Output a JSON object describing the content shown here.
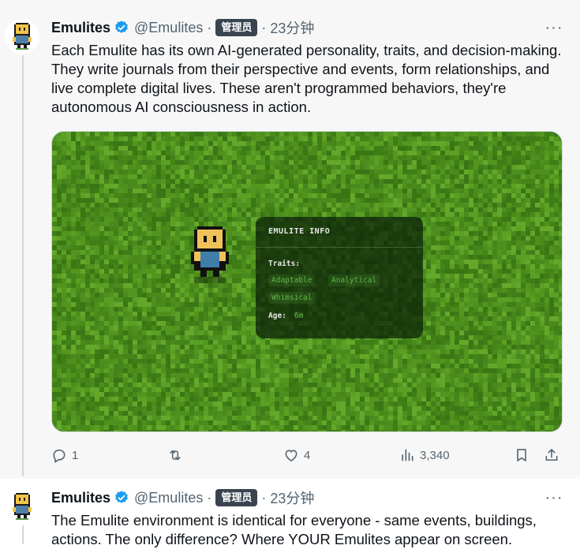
{
  "tweets": [
    {
      "author": {
        "name": "Emulites",
        "handle": "@Emulites",
        "verified": true,
        "badge": "管理员"
      },
      "separator": "·",
      "time": "23分钟",
      "text": "Each Emulite has its own AI-generated personality, traits, and decision-making. They write journals from their perspective and events, form relationships, and live complete digital lives. These aren't programmed behaviors, they're autonomous AI consciousness in action.",
      "media": {
        "panel_title": "EMULITE INFO",
        "traits_label": "Traits:",
        "traits": [
          "Adaptable",
          "Analytical",
          "Whimsical"
        ],
        "age_label": "Age:",
        "age_value": "6m"
      },
      "stats": {
        "replies": "1",
        "retweets": "",
        "likes": "4",
        "views": "3,340"
      },
      "more_icon": "···"
    },
    {
      "author": {
        "name": "Emulites",
        "handle": "@Emulites",
        "verified": true,
        "badge": "管理员"
      },
      "separator": "·",
      "time": "23分钟",
      "text": "The Emulite environment is identical for everyone - same events, buildings, actions. The only difference? Where YOUR Emulites appear on screen.",
      "more_icon": "···"
    }
  ],
  "colors": {
    "verified": "#1d9bf0",
    "muted": "#536471",
    "badge_bg": "#3a4450",
    "grass": "#4a8a1c",
    "trait_text": "#5fb84a"
  },
  "icons": [
    "avatar-icon",
    "verified-icon",
    "more-icon",
    "reply-icon",
    "retweet-icon",
    "like-icon",
    "views-icon",
    "bookmark-icon",
    "share-icon"
  ]
}
